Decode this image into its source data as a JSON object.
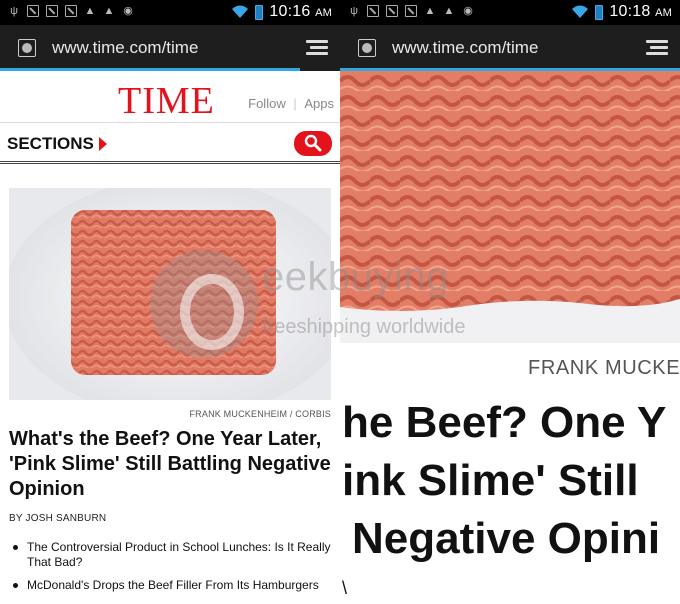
{
  "status": {
    "time_left": "10:16",
    "time_right": "10:18",
    "ampm": "AM"
  },
  "browser": {
    "url": "www.time.com/time"
  },
  "header": {
    "logo": "TIME",
    "follow": "Follow",
    "apps": "Apps"
  },
  "nav": {
    "sections": "SECTIONS"
  },
  "article": {
    "photo_credit": "FRANK MUCKENHEIM / CORBIS",
    "headline": "What's the Beef? One Year Later, 'Pink Slime' Still Battling Negative Opinion",
    "byline": "BY JOSH SANBURN",
    "related": [
      "The Controversial Product in School Lunches: Is It Really That Bad?",
      "McDonald's Drops the Beef Filler From Its Hamburgers"
    ]
  },
  "zoomed": {
    "credit": "FRANK MUCKE",
    "line1": "he Beef? One Y",
    "line2": "ink Slime' Still",
    "line3": "Negative Opini",
    "stray": "\\"
  },
  "watermark": {
    "brand": "eekbuying",
    "tagline": "freeshipping worldwide"
  },
  "colors": {
    "brand_red": "#e4121b",
    "progress_blue": "#33a8e0"
  }
}
